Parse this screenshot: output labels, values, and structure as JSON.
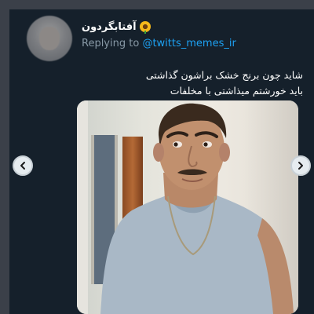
{
  "tweet": {
    "display_name": "آفتابگردون",
    "name_emoji_icon": "sunflower-icon",
    "replying_prefix": "Replying to",
    "replying_to": "@twitts_memes_ir",
    "text_lines": [
      "شاید چون برنج خشک براشون گذاشتی",
      "باید خورشتم میذاشتی با مخلفات"
    ]
  },
  "media": {
    "navigation": {
      "previous_icon": "chevron-left-icon",
      "next_icon": "chevron-right-icon"
    }
  },
  "colors": {
    "background": "#15202b",
    "mention": "#1da1f2",
    "secondary_text": "#8899a6"
  }
}
